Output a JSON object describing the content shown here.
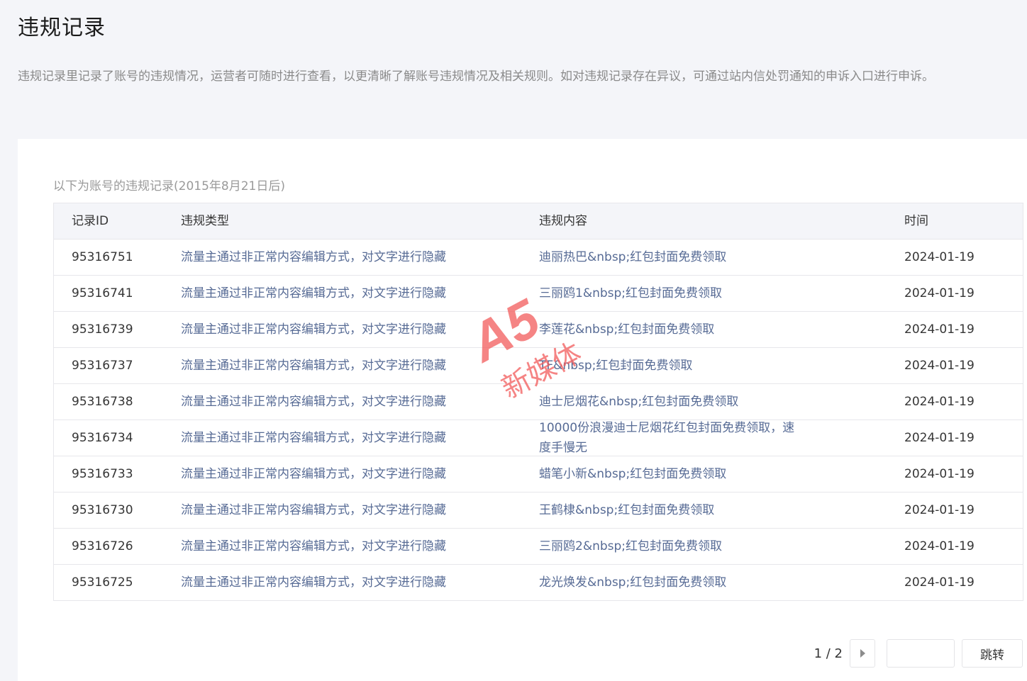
{
  "page": {
    "title": "违规记录",
    "description": "违规记录里记录了账号的违规情况，运营者可随时进行查看，以更清晰了解账号违规情况及相关规则。如对违规记录存在异议，可通过站内信处罚通知的申诉入口进行申诉。"
  },
  "table": {
    "caption": "以下为账号的违规记录(2015年8月21日后)",
    "headers": {
      "id": "记录ID",
      "type": "违规类型",
      "content": "违规内容",
      "time": "时间"
    },
    "rows": [
      {
        "id": "95316751",
        "type": "流量主通过非正常内容编辑方式，对文字进行隐藏",
        "content": "迪丽热巴&nbsp;红包封面免费领取",
        "time": "2024-01-19"
      },
      {
        "id": "95316741",
        "type": "流量主通过非正常内容编辑方式，对文字进行隐藏",
        "content": "三丽鸥1&nbsp;红包封面免费领取",
        "time": "2024-01-19"
      },
      {
        "id": "95316739",
        "type": "流量主通过非正常内容编辑方式，对文字进行隐藏",
        "content": "李莲花&nbsp;红包封面免费领取",
        "time": "2024-01-19"
      },
      {
        "id": "95316737",
        "type": "流量主通过非正常内容编辑方式，对文字进行隐藏",
        "content": "TF&nbsp;红包封面免费领取",
        "time": "2024-01-19"
      },
      {
        "id": "95316738",
        "type": "流量主通过非正常内容编辑方式，对文字进行隐藏",
        "content": "迪士尼烟花&nbsp;红包封面免费领取",
        "time": "2024-01-19"
      },
      {
        "id": "95316734",
        "type": "流量主通过非正常内容编辑方式，对文字进行隐藏",
        "content": "10000份浪漫迪士尼烟花红包封面免费领取，速度手慢无",
        "time": "2024-01-19"
      },
      {
        "id": "95316733",
        "type": "流量主通过非正常内容编辑方式，对文字进行隐藏",
        "content": "蜡笔小新&nbsp;红包封面免费领取",
        "time": "2024-01-19"
      },
      {
        "id": "95316730",
        "type": "流量主通过非正常内容编辑方式，对文字进行隐藏",
        "content": "王鹤棣&nbsp;红包封面免费领取",
        "time": "2024-01-19"
      },
      {
        "id": "95316726",
        "type": "流量主通过非正常内容编辑方式，对文字进行隐藏",
        "content": "三丽鸥2&nbsp;红包封面免费领取",
        "time": "2024-01-19"
      },
      {
        "id": "95316725",
        "type": "流量主通过非正常内容编辑方式，对文字进行隐藏",
        "content": "龙光焕发&nbsp;红包封面免费领取",
        "time": "2024-01-19"
      }
    ]
  },
  "pagination": {
    "page_indicator": "1 / 2",
    "next_icon": "triangle-right-icon",
    "jump_input_value": "",
    "jump_label": "跳转"
  },
  "watermark": {
    "logo": "A5",
    "text": "新媒体",
    "color": "#f25c5c"
  }
}
